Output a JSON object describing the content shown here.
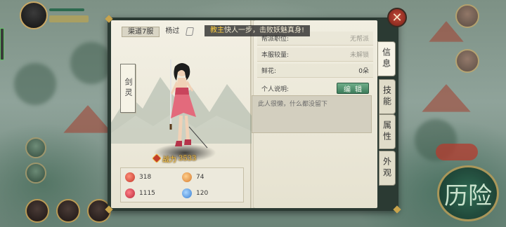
{
  "header": {
    "server": "渠道7服",
    "player_name": "杨过",
    "marquee_highlight": "教主",
    "marquee_text": "快人一步，击败妖魅真身!"
  },
  "character": {
    "sect_tag": "剑灵",
    "power_label": "战力",
    "power_value": "3533"
  },
  "stats": [
    {
      "icon": "attack-icon",
      "value": "318"
    },
    {
      "icon": "defense-icon",
      "value": "74"
    },
    {
      "icon": "health-icon",
      "value": "1115"
    },
    {
      "icon": "speed-icon",
      "value": "120"
    }
  ],
  "info": {
    "rows": [
      {
        "label": "帮派职位:",
        "value": "无帮派"
      },
      {
        "label": "本服较量:",
        "value": "未解锁"
      },
      {
        "label": "鲜花:",
        "value": "0朵"
      }
    ],
    "desc_label": "个人说明:",
    "edit_label": "编辑",
    "desc_text": "此人很懒，什么都没留下"
  },
  "tabs": [
    {
      "label": "信息",
      "active": true
    },
    {
      "label": "技能",
      "active": false
    },
    {
      "label": "属性",
      "active": false
    },
    {
      "label": "外观",
      "active": false
    }
  ],
  "close_label": "✕",
  "hud": {
    "adventure_label": "历险"
  },
  "colors": {
    "accent_gold": "#f2c24d",
    "edit_green": "#3c7c5b",
    "close_red": "#c24a3a"
  }
}
